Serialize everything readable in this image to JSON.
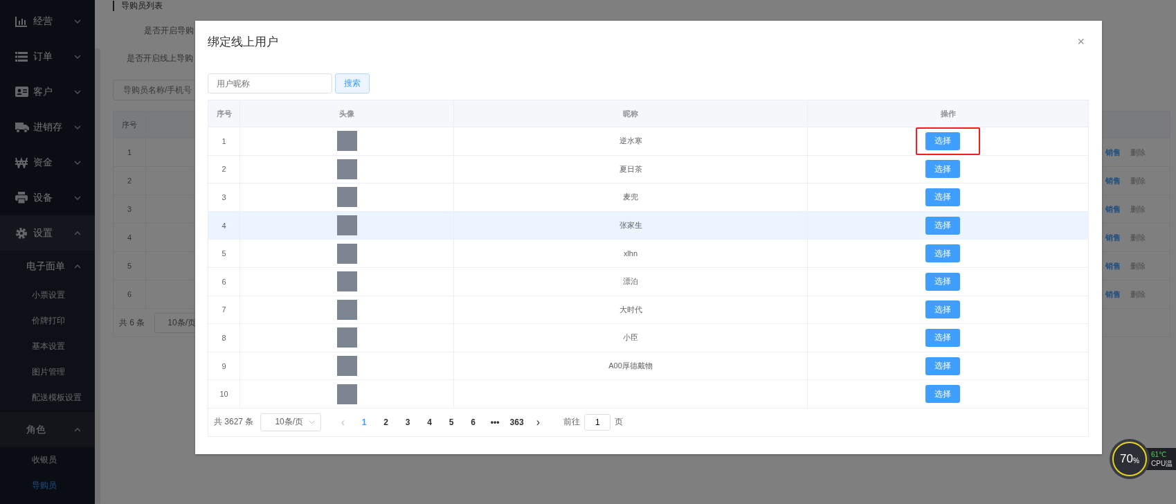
{
  "sidebar": {
    "items": [
      {
        "label": "经营",
        "kind": "chart",
        "expanded": false
      },
      {
        "label": "订单",
        "kind": "list",
        "expanded": false
      },
      {
        "label": "客户",
        "kind": "card",
        "expanded": false
      },
      {
        "label": "进销存",
        "kind": "truck",
        "expanded": false
      },
      {
        "label": "资金",
        "kind": "won",
        "expanded": false
      },
      {
        "label": "设备",
        "kind": "printer",
        "expanded": false
      },
      {
        "label": "设置",
        "kind": "gear",
        "expanded": true,
        "children": [
          {
            "label": "电子面单",
            "expanded": true,
            "children": [
              {
                "label": "小票设置",
                "selected": false
              },
              {
                "label": "价牌打印",
                "selected": false
              },
              {
                "label": "基本设置",
                "selected": false
              },
              {
                "label": "图片管理",
                "selected": false
              },
              {
                "label": "配送模板设置",
                "selected": false
              }
            ]
          },
          {
            "label": "角色",
            "expanded": true,
            "children": [
              {
                "label": "收银员",
                "selected": false
              },
              {
                "label": "导购员",
                "selected": true
              }
            ]
          }
        ]
      }
    ]
  },
  "page": {
    "title": "导购员列表",
    "settings": [
      "是否开启导购",
      "是否开启线上导购"
    ],
    "search": {
      "placeholder": "导购员名称/手机号"
    },
    "table": {
      "columns": [
        "序号"
      ],
      "rows": [
        {
          "index": "1",
          "actions": [
            "销售",
            "删除"
          ]
        },
        {
          "index": "2",
          "actions": [
            "销售",
            "删除"
          ]
        },
        {
          "index": "3",
          "actions": [
            "销售",
            "删除"
          ]
        },
        {
          "index": "4",
          "actions": [
            "销售",
            "删除"
          ]
        },
        {
          "index": "5",
          "actions": [
            "销售",
            "删除"
          ]
        },
        {
          "index": "6",
          "actions": [
            "销售",
            "删除"
          ]
        }
      ],
      "total": "共 6 条",
      "page_size": "10条/页"
    }
  },
  "dialog": {
    "title": "绑定线上用户",
    "close": "×",
    "search": {
      "placeholder": "用户昵称",
      "button": "搜索"
    },
    "table": {
      "columns": [
        "序号",
        "头像",
        "昵称",
        "操作"
      ],
      "rows": [
        {
          "index": "1",
          "nickname": "逆水寒",
          "action": "选择",
          "highlighted": false,
          "annotated": true
        },
        {
          "index": "2",
          "nickname": "夏日茶",
          "action": "选择",
          "highlighted": false,
          "annotated": false
        },
        {
          "index": "3",
          "nickname": "麦兜",
          "action": "选择",
          "highlighted": false,
          "annotated": false
        },
        {
          "index": "4",
          "nickname": "张家生",
          "action": "选择",
          "highlighted": true,
          "annotated": false
        },
        {
          "index": "5",
          "nickname": "xlhn",
          "action": "选择",
          "highlighted": false,
          "annotated": false
        },
        {
          "index": "6",
          "nickname": "漂泊",
          "action": "选择",
          "highlighted": false,
          "annotated": false
        },
        {
          "index": "7",
          "nickname": "大时代",
          "action": "选择",
          "highlighted": false,
          "annotated": false
        },
        {
          "index": "8",
          "nickname": "小臣",
          "action": "选择",
          "highlighted": false,
          "annotated": false
        },
        {
          "index": "9",
          "nickname": "A00厚德戴物",
          "action": "选择",
          "highlighted": false,
          "annotated": false
        },
        {
          "index": "10",
          "action": "选择",
          "highlighted": false,
          "annotated": false
        }
      ]
    },
    "pagination": {
      "total": "共 3627 条",
      "page_size": "10条/页",
      "prev": "‹",
      "next": "›",
      "pages": [
        {
          "label": "1",
          "selected": true
        },
        {
          "label": "2",
          "selected": false
        },
        {
          "label": "3",
          "selected": false
        },
        {
          "label": "4",
          "selected": false
        },
        {
          "label": "5",
          "selected": false
        },
        {
          "label": "6",
          "selected": false
        },
        {
          "label": "•••",
          "selected": false
        },
        {
          "label": "363",
          "selected": false
        }
      ],
      "goto_label": "前往",
      "goto_value": "1",
      "goto_unit": "页"
    }
  },
  "cpu_widget": {
    "usage": "70",
    "unit": "%",
    "temperature": "61℃",
    "label": "CPU温"
  }
}
